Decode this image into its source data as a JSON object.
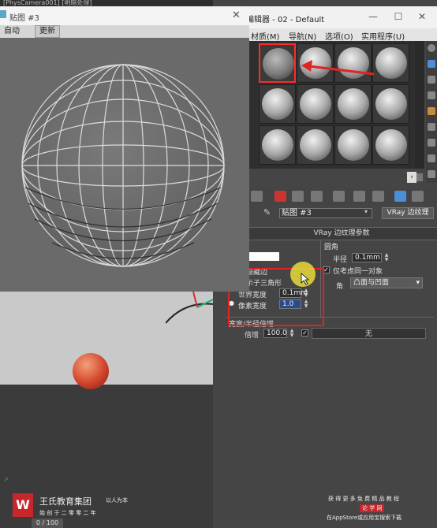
{
  "viewport": {
    "camera_label": "[PhysCamera001] [明暗处理]"
  },
  "material_editor": {
    "title": "编辑器 - 02 - Default",
    "menu": [
      "材质(M)",
      "导航(N)",
      "选项(O)",
      "实用程序(U)"
    ],
    "map_name": "贴图 #3",
    "map_type": "VRay 边纹理",
    "rollout_title": "VRay 边纹理参数",
    "params": {
      "bevel_group": "圆角",
      "radius_label": "半径",
      "radius_value": "0.1mm",
      "same_object_label": "仅考虑同一对象",
      "corners_label": "角",
      "corners_value": "凸面与凹面",
      "edges_label": "隐藏边",
      "hide_triangles_label": "示子三角形",
      "world_width_label": "世界宽度",
      "world_width_value": "0.1mm",
      "pixel_width_label": "像素宽度",
      "pixel_width_value": "1.0",
      "width_mult_label": "宽度/半径倍增",
      "multiplier_label": "倍增",
      "multiplier_value": "100.0",
      "none_button": "无"
    }
  },
  "map_window": {
    "title": "贴图 #3",
    "tabs": [
      "自动",
      "更新"
    ]
  },
  "watermark": {
    "brand": "王氏教育集团",
    "slogan": "以人为本",
    "tagline": "始 创 于 二 零 零 二 年",
    "promo_line1": "获 得 更 多 免 费 精 品 教 程",
    "promo_badge": "论 学 网",
    "promo_line2": "在AppStore或应用宝搜索下载",
    "time": "0 / 100"
  },
  "colors": {
    "highlight_red": "#e02424",
    "panel": "#454545"
  }
}
